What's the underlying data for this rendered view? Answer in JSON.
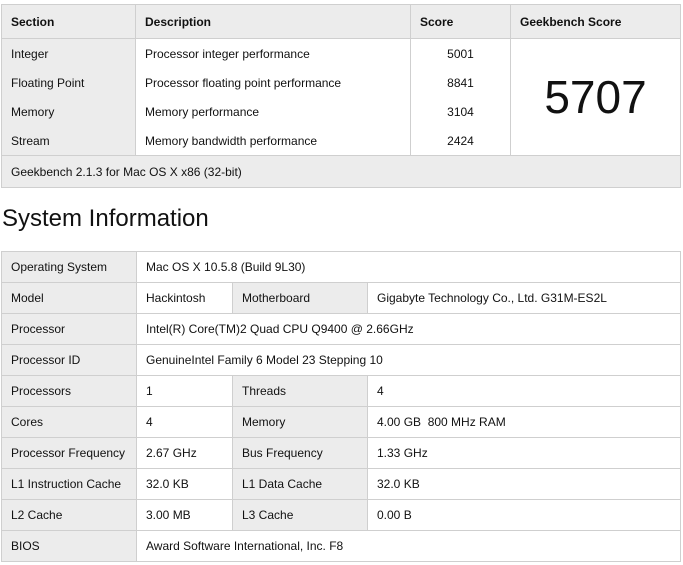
{
  "score_table": {
    "headers": {
      "section": "Section",
      "description": "Description",
      "score": "Score",
      "geekbench": "Geekbench Score"
    },
    "rows": [
      {
        "section": "Integer",
        "description": "Processor integer performance",
        "score": "5001"
      },
      {
        "section": "Floating Point",
        "description": "Processor floating point performance",
        "score": "8841"
      },
      {
        "section": "Memory",
        "description": "Memory performance",
        "score": "3104"
      },
      {
        "section": "Stream",
        "description": "Memory bandwidth performance",
        "score": "2424"
      }
    ],
    "geekbench_score": "5707",
    "footer": "Geekbench 2.1.3 for Mac OS X x86 (32-bit)"
  },
  "system_info": {
    "title": "System Information",
    "os_label": "Operating System",
    "os_value": "Mac OS X 10.5.8 (Build 9L30)",
    "model_label": "Model",
    "model_value": "Hackintosh",
    "motherboard_label": "Motherboard",
    "motherboard_value": "Gigabyte Technology Co., Ltd. G31M-ES2L",
    "processor_label": "Processor",
    "processor_value": "Intel(R) Core(TM)2 Quad CPU Q9400 @ 2.66GHz",
    "processor_id_label": "Processor ID",
    "processor_id_value": "GenuineIntel Family 6 Model 23 Stepping 10",
    "processors_label": "Processors",
    "processors_value": "1",
    "threads_label": "Threads",
    "threads_value": "4",
    "cores_label": "Cores",
    "cores_value": "4",
    "memory_label": "Memory",
    "memory_value": "4.00 GB  800 MHz RAM",
    "freq_label": "Processor Frequency",
    "freq_value": "2.67 GHz",
    "bus_label": "Bus Frequency",
    "bus_value": "1.33 GHz",
    "l1i_label": "L1 Instruction Cache",
    "l1i_value": "32.0 KB",
    "l1d_label": "L1 Data Cache",
    "l1d_value": "32.0 KB",
    "l2_label": "L2 Cache",
    "l2_value": "3.00 MB",
    "l3_label": "L3 Cache",
    "l3_value": "0.00 B",
    "bios_label": "BIOS",
    "bios_value": "Award Software International, Inc. F8"
  }
}
